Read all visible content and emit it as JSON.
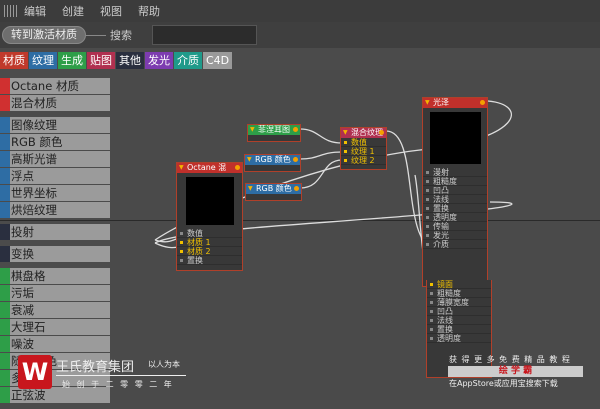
{
  "menu": {
    "items": [
      "编辑",
      "创建",
      "视图",
      "帮助"
    ]
  },
  "toolbar": {
    "go_button": "转到激活材质",
    "search_label": "搜索",
    "search_value": ""
  },
  "tabs": [
    {
      "label": "材质",
      "color": "#c0392b"
    },
    {
      "label": "纹理",
      "color": "#2e6da4"
    },
    {
      "label": "生成",
      "color": "#2e9e48"
    },
    {
      "label": "贴图",
      "color": "#b03050"
    },
    {
      "label": "其他",
      "color": "#2a2f3f"
    },
    {
      "label": "发光",
      "color": "#7d3cb0"
    },
    {
      "label": "介质",
      "color": "#1f9a8a"
    },
    {
      "label": "C4D",
      "color": "#9a9a9a"
    }
  ],
  "sidebar": {
    "groups": [
      {
        "color": "#d03030",
        "items": [
          "Octane 材质",
          "混合材质"
        ]
      },
      {
        "color": "#2e6da4",
        "items": [
          "图像纹理",
          "RGB 颜色",
          "高斯光谱",
          "浮点",
          "世界坐标",
          "烘焙纹理"
        ]
      },
      {
        "color": "#2a2f3f",
        "items": [
          "投射"
        ]
      },
      {
        "color": "#2a2f3f",
        "items": [
          "变换"
        ]
      },
      {
        "color": "#2e9e48",
        "items": [
          "棋盘格",
          "污垢",
          "衰减",
          "大理石",
          "噪波",
          "随机颜色",
          "多边形",
          "正弦波"
        ]
      }
    ]
  },
  "nodes": {
    "falloff": {
      "title": "菲涅耳图"
    },
    "rgb1": {
      "title": "RGB 颜色"
    },
    "rgb2": {
      "title": "RGB 颜色"
    },
    "mix_tex": {
      "title": "混合纹理",
      "ports": [
        "数值",
        "纹理 1",
        "纹理 2"
      ]
    },
    "octane_mix": {
      "title": "Octane 混",
      "ports": [
        "数值",
        "材质 1",
        "材质 2",
        "置换"
      ]
    },
    "glossy": {
      "title": "光泽",
      "ports": [
        "漫射",
        "粗糙度",
        "凹凸",
        "法线",
        "置换",
        "透明度",
        "传输",
        "发光",
        "介质"
      ]
    },
    "specular": {
      "ports": [
        "镜面",
        "粗糙度",
        "薄膜宽度",
        "凹凸",
        "法线",
        "置换",
        "透明度"
      ]
    }
  },
  "watermark": {
    "brand": "王氏教育集团",
    "slogan": "以人为本",
    "subtitle": "始 创 于 二 零 零 二 年",
    "promo1": "获 得 更 多 免 费 精 品 教 程",
    "promo_app": "绘 学 霸",
    "promo2": "在AppStore或应用宝搜索下载"
  }
}
